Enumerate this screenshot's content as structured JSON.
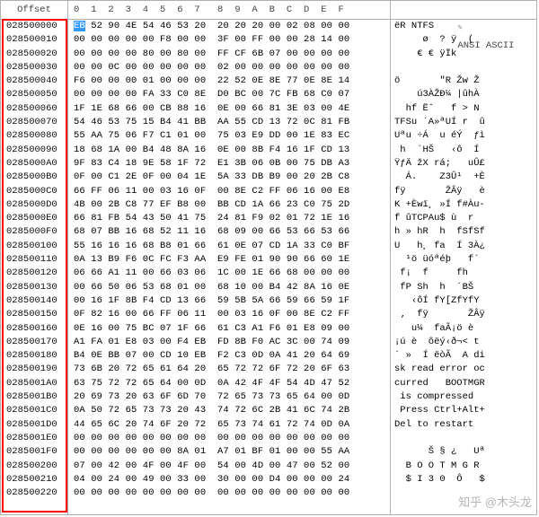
{
  "header": {
    "offset_label": "Offset",
    "hex_cols": "0  1  2  3  4  5  6  7   8  9  A  B  C  D  E  F",
    "ascii_label": "ANSI ASCII"
  },
  "highlight": {
    "target": "offset-column",
    "color": "#ff0000"
  },
  "cursor": {
    "row": 0,
    "byte": 0
  },
  "watermark": "知乎 @木头龙",
  "rows": [
    {
      "offset": "028500000",
      "hex": "EB 52 90 4E 54 46 53 20  20 20 20 00 02 08 00 00",
      "ascii": "ëR NTFS         "
    },
    {
      "offset": "028500010",
      "hex": "00 00 00 00 00 F8 00 00  3F 00 FF 00 00 28 14 00",
      "ascii": "     ø  ? ÿ  (  "
    },
    {
      "offset": "028500020",
      "hex": "00 00 00 00 80 00 80 00  FF CF 6B 07 00 00 00 00",
      "ascii": "    € € ÿÏk     "
    },
    {
      "offset": "028500030",
      "hex": "00 00 0C 00 00 00 00 00  02 00 00 00 00 00 00 00",
      "ascii": "                "
    },
    {
      "offset": "028500040",
      "hex": "F6 00 00 00 01 00 00 00  22 52 0E 8E 77 0E 8E 14",
      "ascii": "ö       \"R Žw Ž "
    },
    {
      "offset": "028500050",
      "hex": "00 00 00 00 FA 33 C0 8E  D0 BC 00 7C FB 68 C0 07",
      "ascii": "    ú3ÀŽÐ¼ |ûhÀ "
    },
    {
      "offset": "028500060",
      "hex": "1F 1E 68 66 00 CB 88 16  0E 00 66 81 3E 03 00 4E",
      "ascii": "  hf Ëˆ   f > N"
    },
    {
      "offset": "028500070",
      "hex": "54 46 53 75 15 B4 41 BB  AA 55 CD 13 72 0C 81 FB",
      "ascii": "TFSu ´A»ªUÍ r  û"
    },
    {
      "offset": "028500080",
      "hex": "55 AA 75 06 F7 C1 01 00  75 03 E9 DD 00 1E 83 EC",
      "ascii": "Uªu ÷Á  u éÝ  ƒì"
    },
    {
      "offset": "028500090",
      "hex": "18 68 1A 00 B4 48 8A 16  0E 00 8B F4 16 1F CD 13",
      "ascii": " h  ´HŠ   ‹ô  Í "
    },
    {
      "offset": "0285000A0",
      "hex": "9F 83 C4 18 9E 58 1F 72  E1 3B 06 0B 00 75 DB A3",
      "ascii": "ŸƒÄ žX rá;   uÛ£"
    },
    {
      "offset": "0285000B0",
      "hex": "0F 00 C1 2E 0F 00 04 1E  5A 33 DB B9 00 20 2B C8",
      "ascii": "  Á.    Z3Û¹  +È"
    },
    {
      "offset": "0285000C0",
      "hex": "66 FF 06 11 00 03 16 0F  00 8E C2 FF 06 16 00 E8",
      "ascii": "fÿ       ŽÂÿ   è"
    },
    {
      "offset": "0285000D0",
      "hex": "4B 00 2B C8 77 EF B8 00  BB CD 1A 66 23 C0 75 2D",
      "ascii": "K +Èwï¸ »Í f#Àu-"
    },
    {
      "offset": "0285000E0",
      "hex": "66 81 FB 54 43 50 41 75  24 81 F9 02 01 72 1E 16",
      "ascii": "f ûTCPAu$ ù  r  "
    },
    {
      "offset": "0285000F0",
      "hex": "68 07 BB 16 68 52 11 16  68 09 00 66 53 66 53 66",
      "ascii": "h » hR  h  fSfSf"
    },
    {
      "offset": "028500100",
      "hex": "55 16 16 16 68 B8 01 66  61 0E 07 CD 1A 33 C0 BF",
      "ascii": "U   h¸ fa  Í 3À¿"
    },
    {
      "offset": "028500110",
      "hex": "0A 13 B9 F6 0C FC F3 AA  E9 FE 01 90 90 66 60 1E",
      "ascii": "  ¹ö üóªéþ   f` "
    },
    {
      "offset": "028500120",
      "hex": "06 66 A1 11 00 66 03 06  1C 00 1E 66 68 00 00 00",
      "ascii": " f¡  f     fh   "
    },
    {
      "offset": "028500130",
      "hex": "00 66 50 06 53 68 01 00  68 10 00 B4 42 8A 16 0E",
      "ascii": " fP Sh  h  ´BŠ  "
    },
    {
      "offset": "028500140",
      "hex": "00 16 1F 8B F4 CD 13 66  59 5B 5A 66 59 66 59 1F",
      "ascii": "   ‹ôÍ fY[ZfYfY "
    },
    {
      "offset": "028500150",
      "hex": "0F 82 16 00 66 FF 06 11  00 03 16 0F 00 8E C2 FF",
      "ascii": " ‚  fÿ       ŽÂÿ"
    },
    {
      "offset": "028500160",
      "hex": "0E 16 00 75 BC 07 1F 66  61 C3 A1 F6 01 E8 09 00",
      "ascii": "   u¼  faÃ¡ö è  "
    },
    {
      "offset": "028500170",
      "hex": "A1 FA 01 E8 03 00 F4 EB  FD 8B F0 AC 3C 00 74 09",
      "ascii": "¡ú è  ôëý‹ð¬< t "
    },
    {
      "offset": "028500180",
      "hex": "B4 0E BB 07 00 CD 10 EB  F2 C3 0D 0A 41 20 64 69",
      "ascii": "´ »  Í ëòÃ  A di"
    },
    {
      "offset": "028500190",
      "hex": "73 6B 20 72 65 61 64 20  65 72 72 6F 72 20 6F 63",
      "ascii": "sk read error oc"
    },
    {
      "offset": "0285001A0",
      "hex": "63 75 72 72 65 64 00 0D  0A 42 4F 4F 54 4D 47 52",
      "ascii": "curred   BOOTMGR"
    },
    {
      "offset": "0285001B0",
      "hex": "20 69 73 20 63 6F 6D 70  72 65 73 73 65 64 00 0D",
      "ascii": " is compressed  "
    },
    {
      "offset": "0285001C0",
      "hex": "0A 50 72 65 73 73 20 43  74 72 6C 2B 41 6C 74 2B",
      "ascii": " Press Ctrl+Alt+"
    },
    {
      "offset": "0285001D0",
      "hex": "44 65 6C 20 74 6F 20 72  65 73 74 61 72 74 0D 0A",
      "ascii": "Del to restart  "
    },
    {
      "offset": "0285001E0",
      "hex": "00 00 00 00 00 00 00 00  00 00 00 00 00 00 00 00",
      "ascii": "                "
    },
    {
      "offset": "0285001F0",
      "hex": "00 00 00 00 00 00 8A 01  A7 01 BF 01 00 00 55 AA",
      "ascii": "      Š § ¿   Uª"
    },
    {
      "offset": "028500200",
      "hex": "07 00 42 00 4F 00 4F 00  54 00 4D 00 47 00 52 00",
      "ascii": "  B O O T M G R "
    },
    {
      "offset": "028500210",
      "hex": "04 00 24 00 49 00 33 00  30 00 00 D4 00 00 00 24",
      "ascii": "  $ I 3 0  Ô   $"
    },
    {
      "offset": "028500220",
      "hex": "00 00 00 00 00 00 00 00  00 00 00 00 00 00 00 00",
      "ascii": "                "
    }
  ]
}
